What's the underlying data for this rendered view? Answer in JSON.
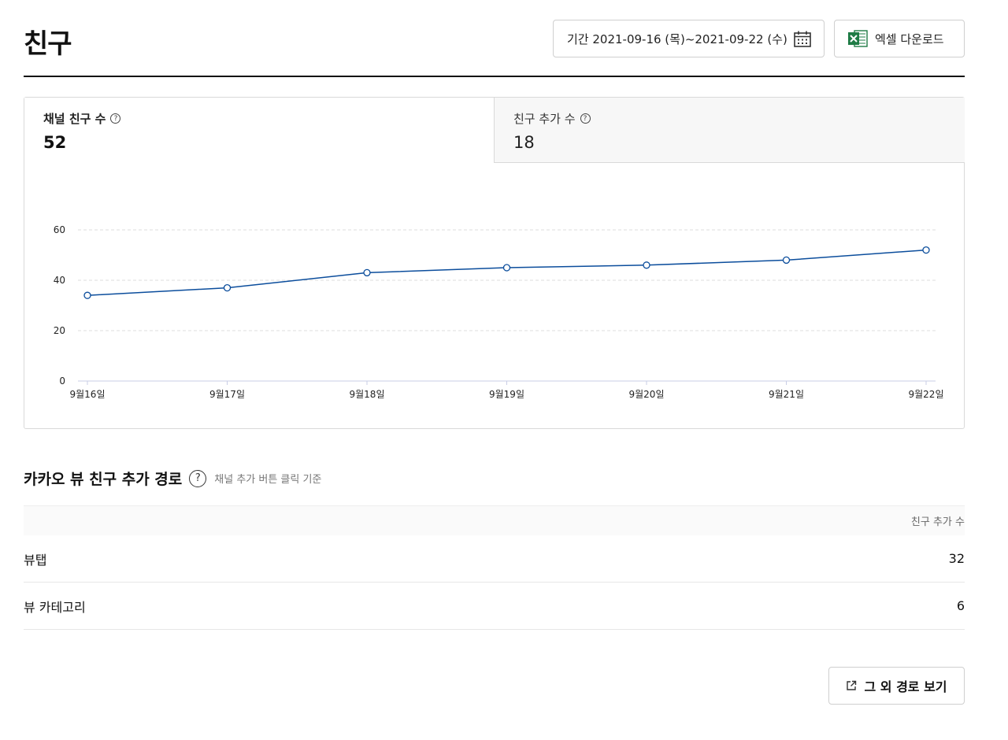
{
  "page": {
    "title": "친구"
  },
  "toolbar": {
    "date_range_label": "기간 2021-09-16 (목)~2021-09-22 (수)",
    "excel_label": "엑셀 다운로드"
  },
  "tabs": [
    {
      "label": "채널 친구 수",
      "value": "52",
      "help": "?"
    },
    {
      "label": "친구 추가 수",
      "value": "18",
      "help": "?"
    }
  ],
  "chart_data": {
    "type": "line",
    "categories": [
      "9월16일",
      "9월17일",
      "9월18일",
      "9월19일",
      "9월20일",
      "9월21일",
      "9월22일"
    ],
    "series": [
      {
        "values": [
          34,
          37,
          43,
          45,
          46,
          48,
          52
        ]
      }
    ],
    "yticks": [
      0,
      20,
      40,
      60
    ],
    "ylim": [
      0,
      60
    ],
    "grid": true,
    "line_color": "#0b4d9c"
  },
  "section": {
    "title": "카카오 뷰 친구 추가 경로",
    "help": "?",
    "subtitle": "채널 추가 버튼 클릭 기준"
  },
  "table": {
    "column_header": "친구 추가 수",
    "rows": [
      {
        "label": "뷰탭",
        "value": "32"
      },
      {
        "label": "뷰 카테고리",
        "value": "6"
      }
    ]
  },
  "more_button": {
    "label": "그 외 경로 보기"
  }
}
